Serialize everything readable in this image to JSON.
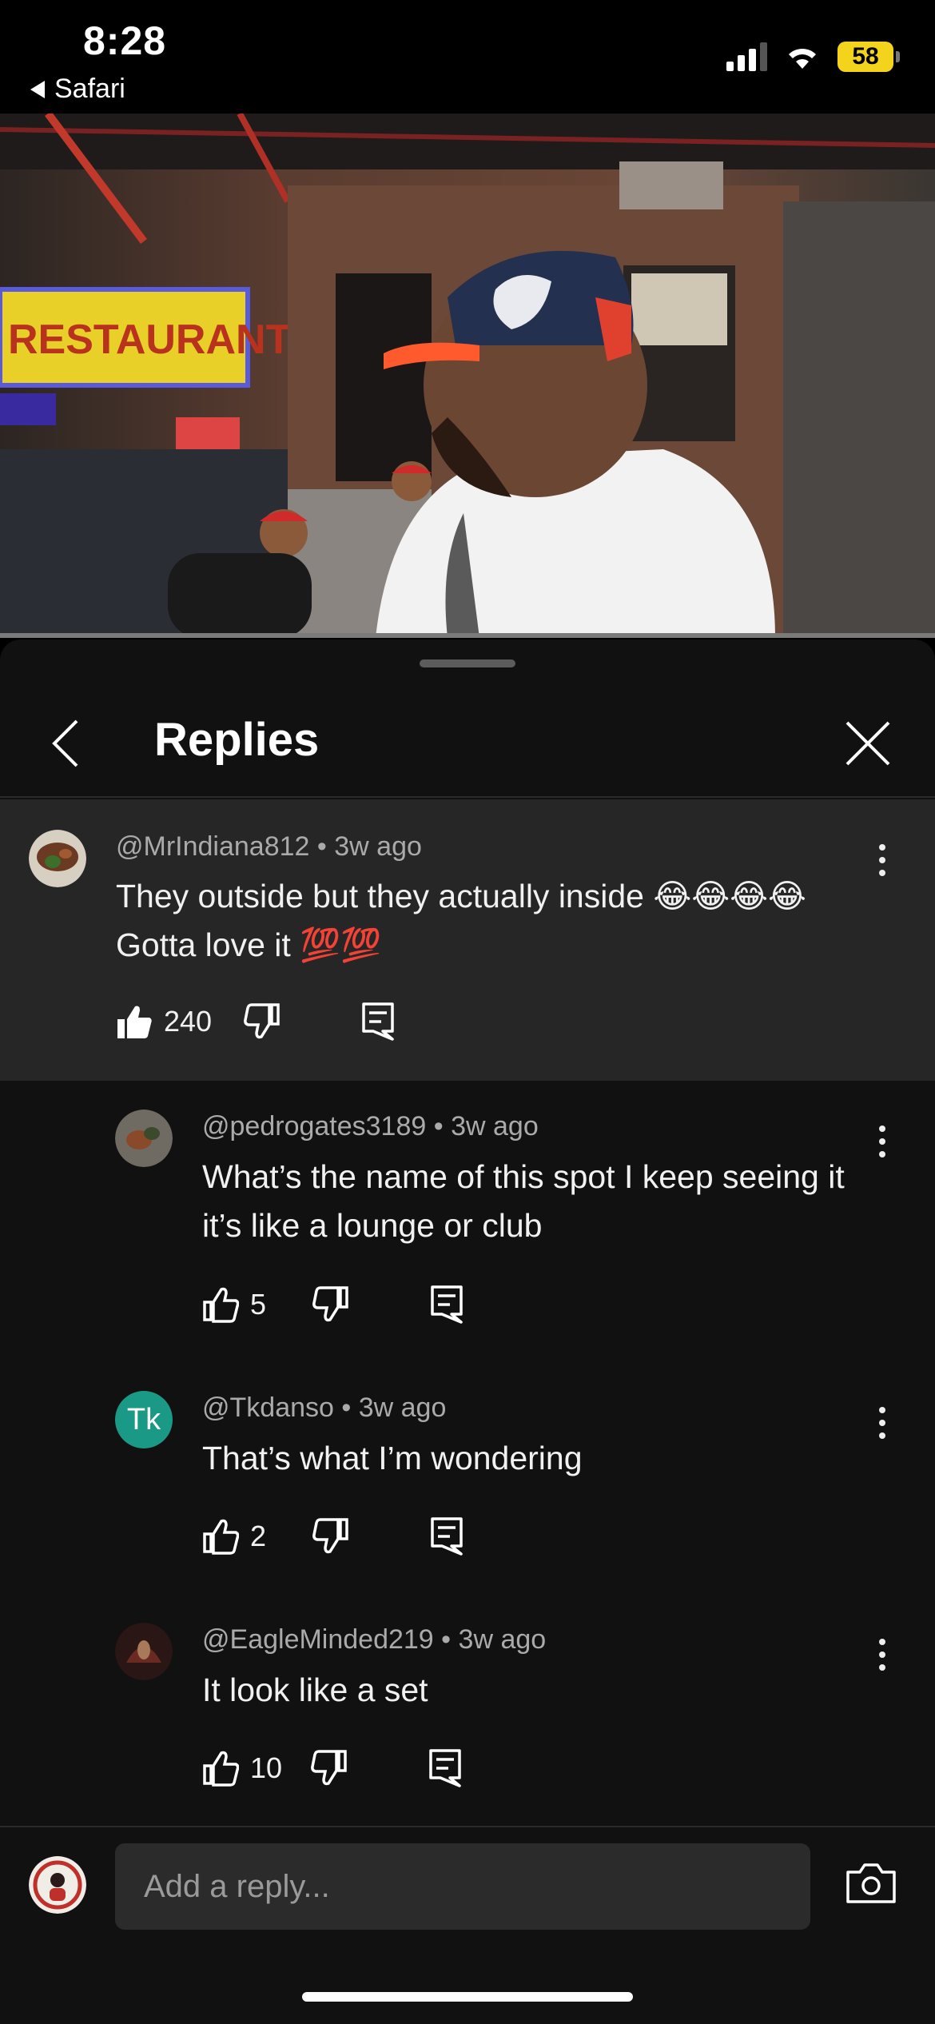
{
  "status_bar": {
    "time": "8:28",
    "back_app": "Safari",
    "battery": "58"
  },
  "header": {
    "title": "Replies"
  },
  "comments": [
    {
      "handle": "@MrIndiana812",
      "age": "3w ago",
      "text": "They outside but they actually inside 😂😂😂😂 Gotta love it 💯💯",
      "likes": "240",
      "avatar_text": ""
    },
    {
      "handle": "@pedrogates3189",
      "age": "3w ago",
      "text": "What’s the name of this spot I keep seeing it it’s like a lounge or club",
      "likes": "5",
      "avatar_text": ""
    },
    {
      "handle": "@Tkdanso",
      "age": "3w ago",
      "text": "That’s what I’m wondering",
      "likes": "2",
      "avatar_text": "Tk"
    },
    {
      "handle": "@EagleMinded219",
      "age": "3w ago",
      "text": "It look like a set",
      "likes": "10",
      "avatar_text": ""
    }
  ],
  "reply_bar": {
    "placeholder": "Add a reply..."
  },
  "colors": {
    "sheet_bg": "#111111",
    "highlight_bg": "#262626",
    "tk_avatar": "#1a9a86",
    "battery": "#f3d31b"
  },
  "icons": {
    "like": "thumbs-up-icon",
    "dislike": "thumbs-down-icon",
    "reply": "comment-icon",
    "more": "kebab-menu-icon",
    "back": "chevron-left-icon",
    "close": "close-icon",
    "camera": "camera-icon"
  }
}
